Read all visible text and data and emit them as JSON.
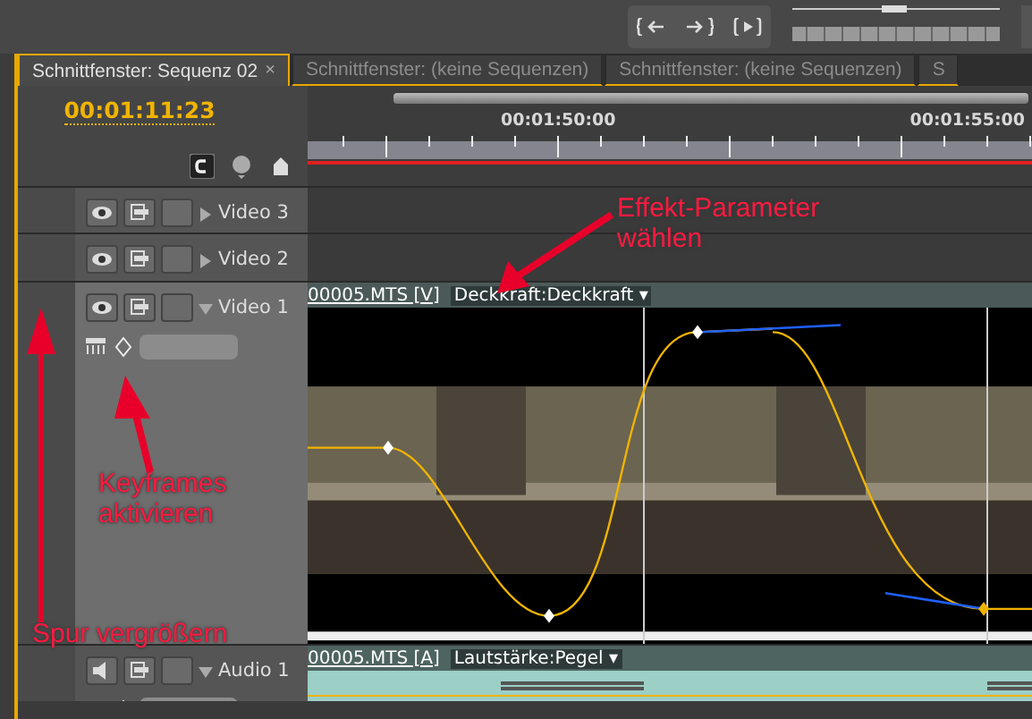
{
  "tabs": [
    {
      "label": "Schnittfenster: Sequenz 02",
      "selected": true,
      "close": "×"
    },
    {
      "label": "Schnittfenster: (keine Sequenzen)",
      "selected": false
    },
    {
      "label": "Schnittfenster: (keine Sequenzen)",
      "selected": false
    },
    {
      "label": "S",
      "selected": false
    }
  ],
  "timecode": "00:01:11:23",
  "ruler": {
    "labels": [
      "00:01:50:00",
      "00:01:55:00"
    ]
  },
  "tracks": [
    {
      "name": "Video 3",
      "kind": "video",
      "expanded": false
    },
    {
      "name": "Video 2",
      "kind": "video",
      "expanded": false
    },
    {
      "name": "Video 1",
      "kind": "video",
      "expanded": true,
      "clip": {
        "name": "00005.MTS [V]",
        "parameter": "Deckkraft:Deckkraft",
        "dropdown": "▾"
      }
    },
    {
      "name": "Audio 1",
      "kind": "audio",
      "expanded": true,
      "clip": {
        "name": "00005.MTS [A]",
        "parameter": "Lautstärke:Pegel",
        "dropdown": "▾"
      }
    }
  ],
  "annotations": [
    {
      "kind": "parameter",
      "text": "Effekt-Parameter wählen"
    },
    {
      "kind": "keyframes",
      "text": "Keyframes aktivieren"
    },
    {
      "kind": "track",
      "text": "Spur vergrößern"
    }
  ]
}
